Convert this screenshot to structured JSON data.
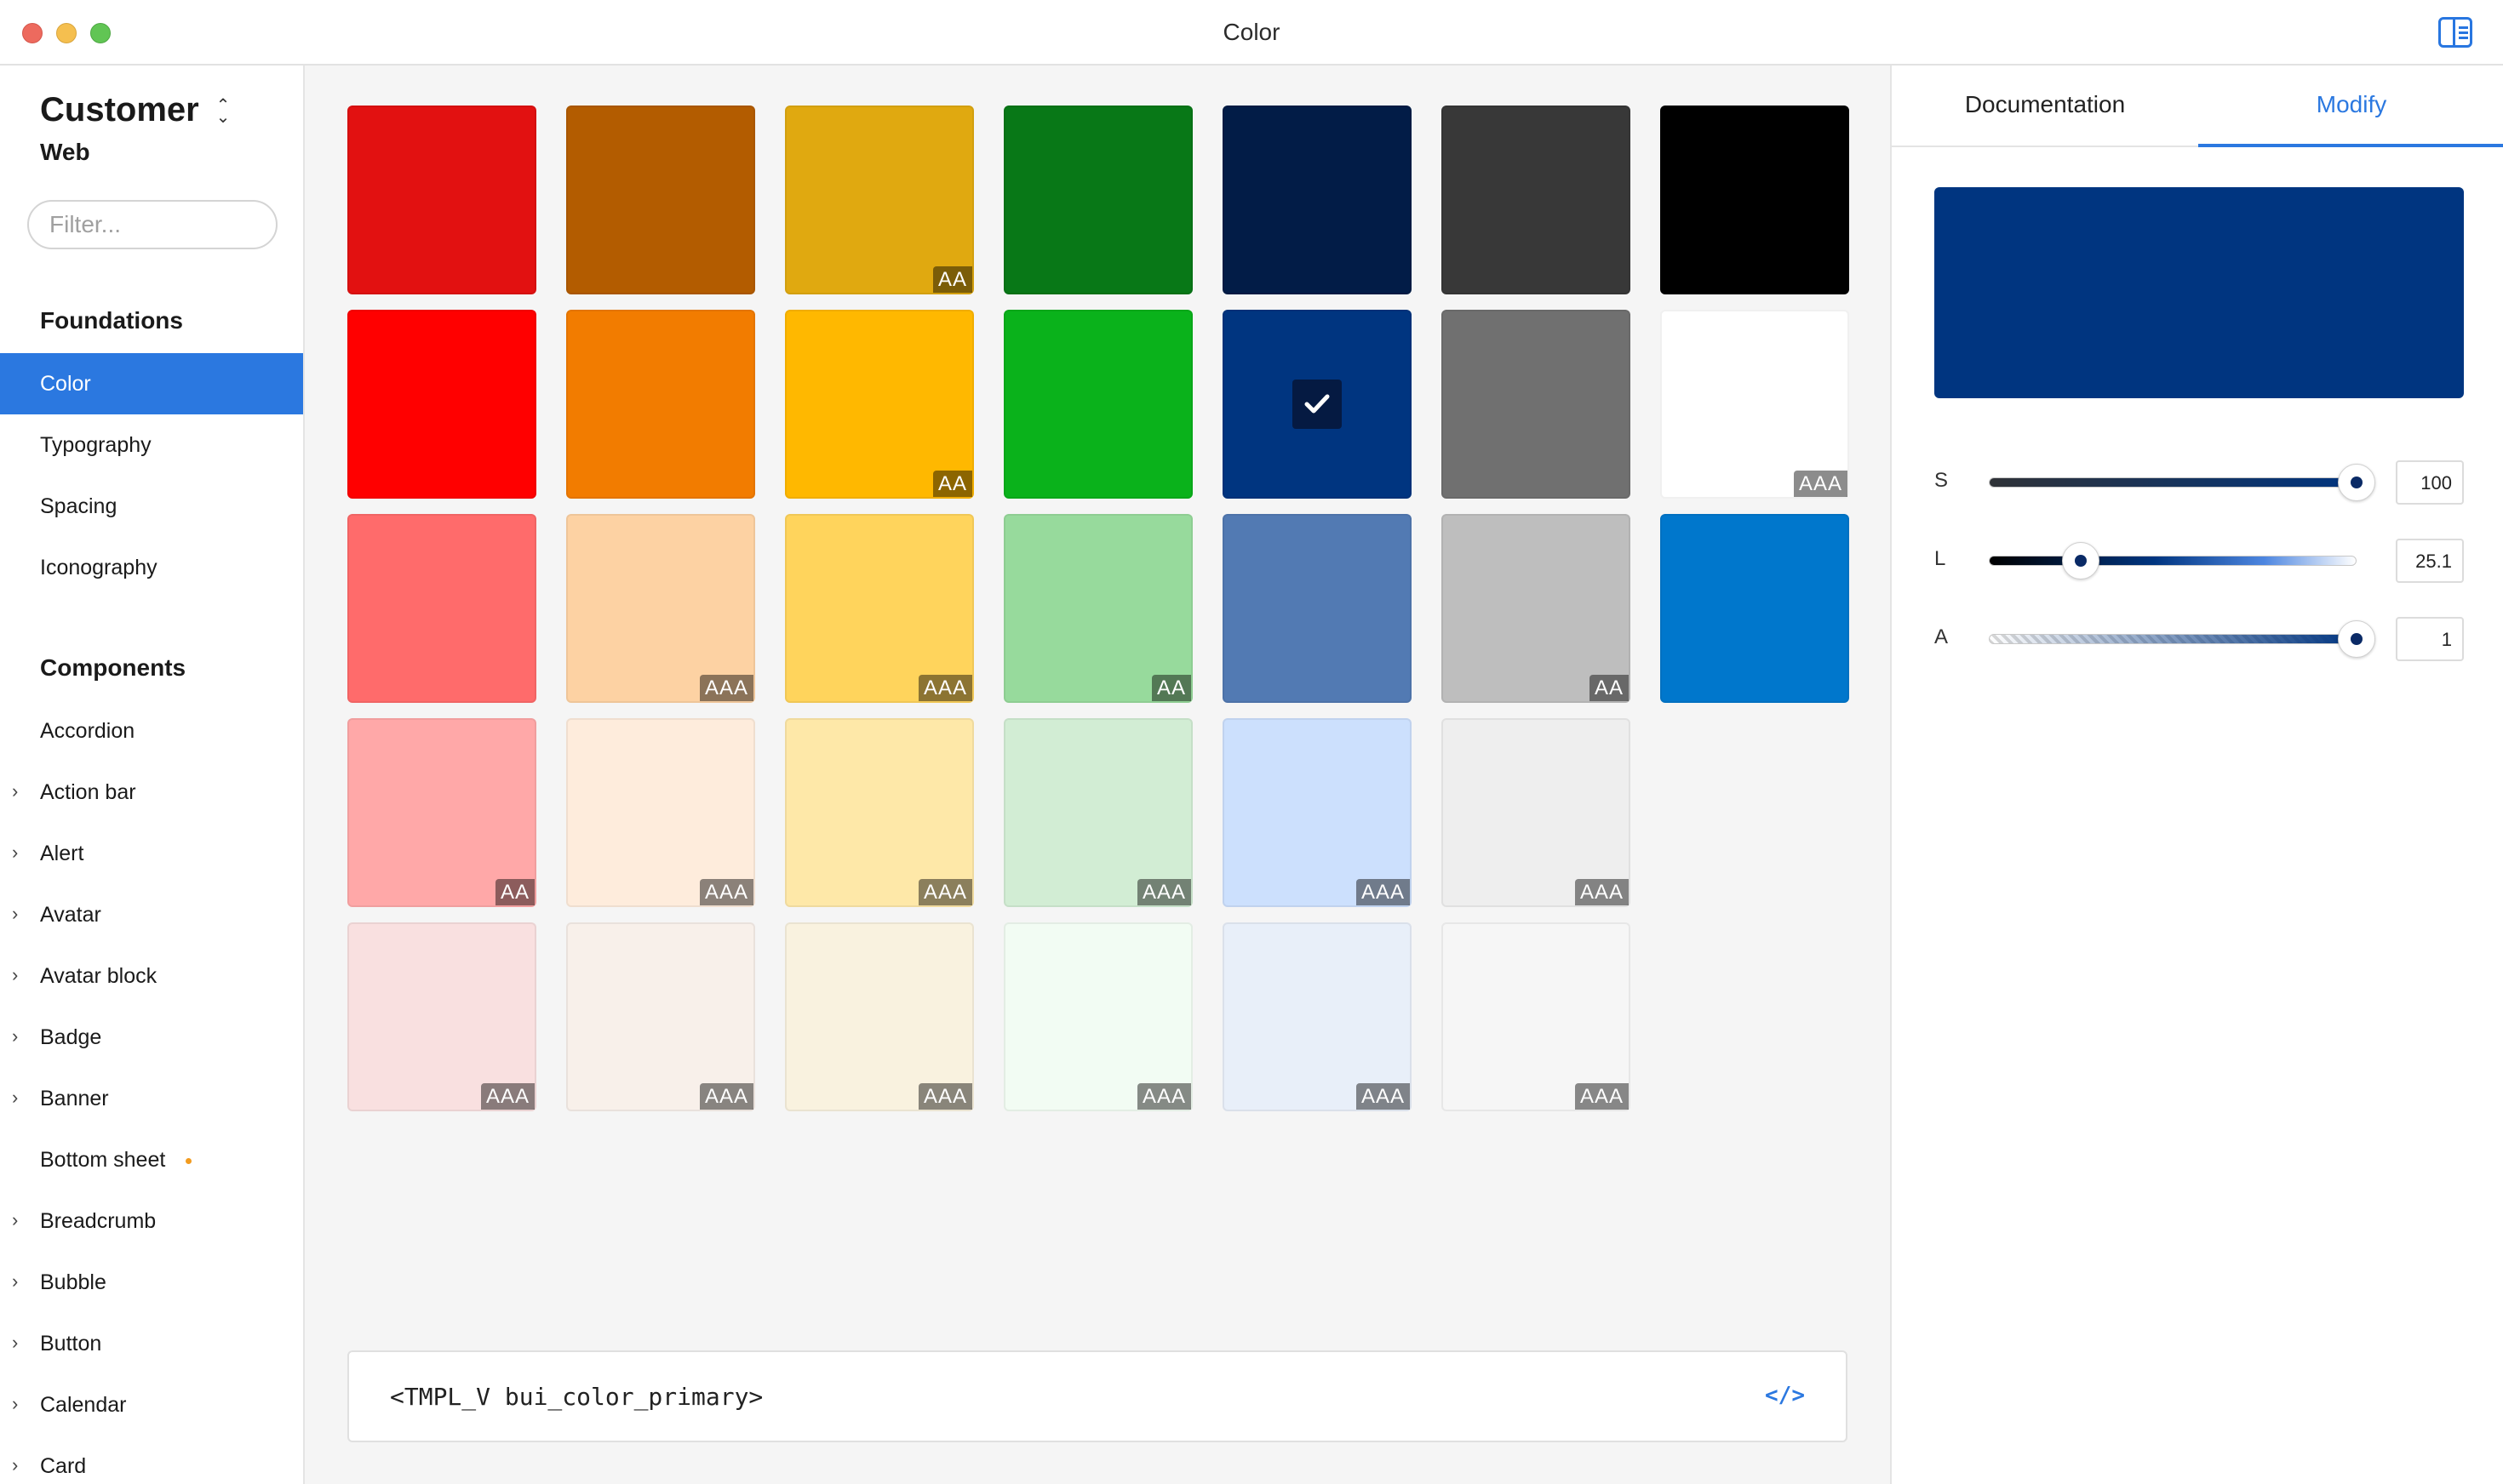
{
  "window": {
    "title": "Color"
  },
  "sidebar": {
    "brand": "Customer",
    "brand_sub": "Web",
    "filter_placeholder": "Filter...",
    "foundations_title": "Foundations",
    "foundations": [
      {
        "label": "Color",
        "active": true
      },
      {
        "label": "Typography"
      },
      {
        "label": "Spacing"
      },
      {
        "label": "Iconography"
      }
    ],
    "components_title": "Components",
    "components": [
      {
        "label": "Accordion",
        "expandable": false
      },
      {
        "label": "Action bar",
        "expandable": true
      },
      {
        "label": "Alert",
        "expandable": true
      },
      {
        "label": "Avatar",
        "expandable": true
      },
      {
        "label": "Avatar block",
        "expandable": true
      },
      {
        "label": "Badge",
        "expandable": true
      },
      {
        "label": "Banner",
        "expandable": true
      },
      {
        "label": "Bottom sheet",
        "expandable": false,
        "dot": true
      },
      {
        "label": "Breadcrumb",
        "expandable": true
      },
      {
        "label": "Bubble",
        "expandable": true
      },
      {
        "label": "Button",
        "expandable": true
      },
      {
        "label": "Calendar",
        "expandable": true
      },
      {
        "label": "Card",
        "expandable": true
      }
    ]
  },
  "swatch_grid": [
    [
      {
        "color": "#e21111",
        "badge": ""
      },
      {
        "color": "#b35c00",
        "badge": ""
      },
      {
        "color": "#e0a910",
        "badge": "AA"
      },
      {
        "color": "#087817",
        "badge": ""
      },
      {
        "color": "#021c47",
        "badge": ""
      },
      {
        "color": "#383838",
        "badge": ""
      },
      {
        "color": "#000000",
        "badge": ""
      }
    ],
    [
      {
        "color": "#ff0000",
        "badge": ""
      },
      {
        "color": "#f27c00",
        "badge": ""
      },
      {
        "color": "#ffb800",
        "badge": "AA"
      },
      {
        "color": "#0ab21b",
        "badge": ""
      },
      {
        "color": "#003580",
        "badge": "",
        "selected": true
      },
      {
        "color": "#707070",
        "badge": ""
      },
      {
        "color": "#ffffff",
        "badge": "AAA"
      }
    ],
    [
      {
        "color": "#ff6b6b",
        "badge": ""
      },
      {
        "color": "#fdd2a3",
        "badge": "AAA"
      },
      {
        "color": "#ffd45c",
        "badge": "AAA"
      },
      {
        "color": "#97da9c",
        "badge": "AA"
      },
      {
        "color": "#527ab3",
        "badge": ""
      },
      {
        "color": "#bebebe",
        "badge": "AA"
      },
      {
        "color": "#0077cc",
        "badge": ""
      }
    ],
    [
      {
        "color": "#ffa8a8",
        "badge": "AA"
      },
      {
        "color": "#feecdc",
        "badge": "AAA"
      },
      {
        "color": "#fee8a8",
        "badge": "AAA"
      },
      {
        "color": "#d2edd4",
        "badge": "AAA"
      },
      {
        "color": "#cce0fd",
        "badge": "AAA"
      },
      {
        "color": "#eeeeee",
        "badge": "AAA"
      }
    ],
    [
      {
        "color": "#f9e0e0",
        "badge": "AAA"
      },
      {
        "color": "#f8f0ea",
        "badge": "AAA"
      },
      {
        "color": "#f9f2df",
        "badge": "AAA"
      },
      {
        "color": "#f2fcf3",
        "badge": "AAA"
      },
      {
        "color": "#e8eff9",
        "badge": "AAA"
      },
      {
        "color": "#f6f6f6",
        "badge": "AAA"
      }
    ]
  ],
  "code": {
    "text": "<TMPL_V bui_color_primary>",
    "icon": "</>"
  },
  "panel": {
    "tabs": [
      {
        "label": "Documentation",
        "active": false
      },
      {
        "label": "Modify",
        "active": true
      }
    ],
    "preview_color": "#003580",
    "sliders": [
      {
        "label": "S",
        "value": "100",
        "fraction": 1.0
      },
      {
        "label": "L",
        "value": "25.1",
        "fraction": 0.251
      },
      {
        "label": "A",
        "value": "1",
        "fraction": 1.0
      }
    ]
  }
}
